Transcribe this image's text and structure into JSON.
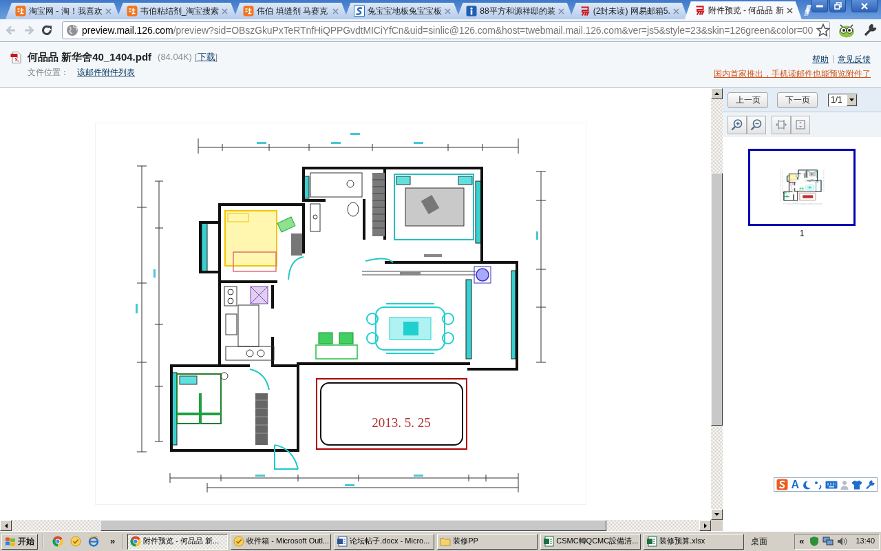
{
  "browser": {
    "tabs": [
      {
        "title": "淘宝网 - 淘！我喜欢",
        "kind": "tile",
        "selected": false
      },
      {
        "title": "韦伯粘结剂_淘宝搜索",
        "kind": "tile",
        "selected": false
      },
      {
        "title": "伟伯 填缝剂 马赛克",
        "kind": "tile",
        "selected": false
      },
      {
        "title": "兔宝宝地板兔宝宝板",
        "kind": "swirl",
        "selected": false
      },
      {
        "title": "88平方和源祥邸的装",
        "kind": "info",
        "selected": false
      },
      {
        "title": "(2封未读) 网易邮箱5.",
        "kind": "mark",
        "selected": false
      },
      {
        "title": "附件预览 - 何品品 新",
        "kind": "mark",
        "selected": true
      }
    ],
    "back_disabled": true,
    "forward_disabled": true,
    "url": {
      "host": "preview.mail.126.com",
      "path": "/preview?sid=OBszGkuPxTeRTnfHiQPPGvdtMICiYfCn&uid=sinlic@126.com&host=twebmail.mail.126.com&ver=js5&style=23&skin=126green&color=00"
    }
  },
  "header": {
    "file_name": "何品品 新华舍40_1404.pdf",
    "file_size": "(84.04K)",
    "download": {
      "open": "[",
      "label": "下载",
      "close": "]"
    },
    "location_label": "文件位置：",
    "location_link": "该邮件附件列表",
    "help_link": "帮助",
    "feedback_link": "意见反馈",
    "promo_link": "国内首家推出，手机读邮件也能预览附件了"
  },
  "viewer": {
    "date_stamp": "2013. 5. 25"
  },
  "side_panel": {
    "prev_button": "上一页",
    "next_button": "下一页",
    "page_select": "1/1",
    "thumbnails": [
      {
        "label": "1",
        "selected": true
      }
    ]
  },
  "ime_toolbar": {
    "mode_label": "A"
  },
  "taskbar": {
    "start_label": "开始",
    "quick_launch_more": "»",
    "tasks": [
      {
        "title": "附件预览 - 何品品 新...",
        "kind": "browser",
        "selected": true
      },
      {
        "title": "收件箱 - Microsoft Outl...",
        "kind": "mail",
        "selected": false
      },
      {
        "title": "论坛帖子.docx - Micro...",
        "kind": "document",
        "selected": false
      },
      {
        "title": "装修PP",
        "kind": "folder",
        "selected": false
      },
      {
        "title": "CSMC轉QCMC設備清...",
        "kind": "sheet",
        "selected": false
      },
      {
        "title": "装修预算.xlsx",
        "kind": "sheet",
        "selected": false
      }
    ],
    "desktop_label": "桌面",
    "tray_more": "«",
    "clock": "13:40"
  }
}
